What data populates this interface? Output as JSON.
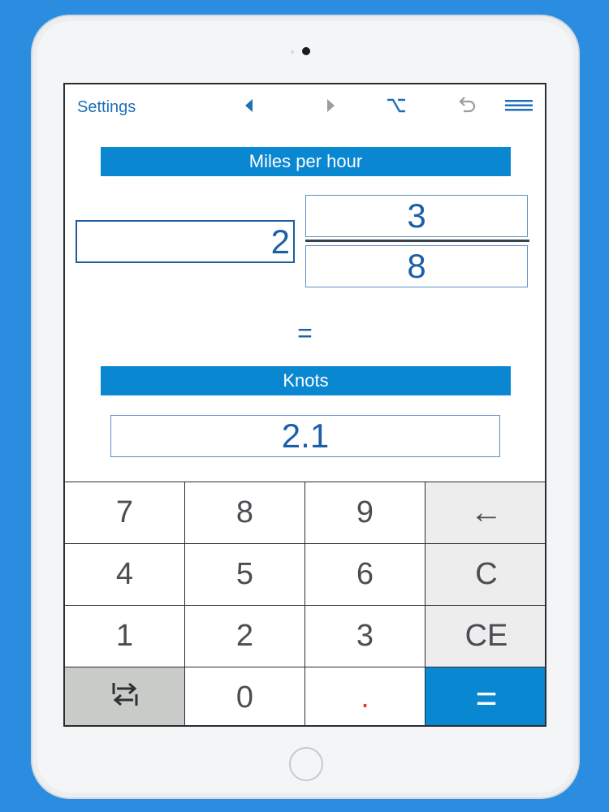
{
  "toolbar": {
    "settings_label": "Settings",
    "icons": [
      "triangle-left-icon",
      "triangle-right-icon",
      "option-key-icon",
      "undo-icon",
      "menu-icon"
    ]
  },
  "converter": {
    "from_unit": "Miles per hour",
    "whole_value": "2",
    "numerator": "3",
    "denominator": "8",
    "equals": "=",
    "to_unit": "Knots",
    "result": "2.1"
  },
  "keypad": {
    "rows": [
      [
        "7",
        "8",
        "9",
        "←"
      ],
      [
        "4",
        "5",
        "6",
        "C"
      ],
      [
        "1",
        "2",
        "3",
        "CE"
      ],
      [
        "",
        "0",
        ".",
        "="
      ]
    ],
    "swap_icon": "swap-arrows-icon"
  },
  "colors": {
    "accent": "#0a87d1",
    "text_blue": "#1a5fa8",
    "background": "#2b8de0",
    "decimal_point": "#e03b2e"
  }
}
